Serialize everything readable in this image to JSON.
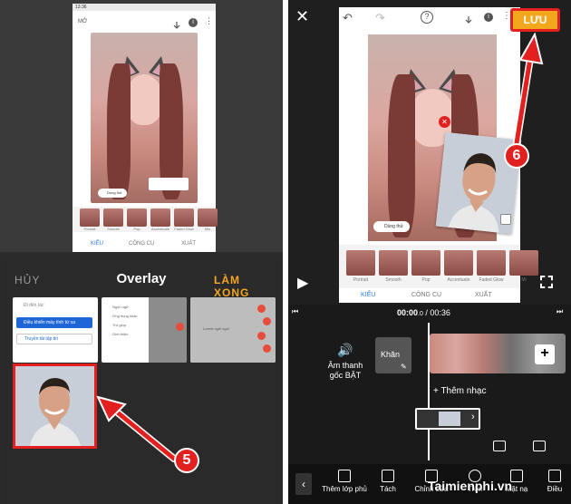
{
  "left": {
    "phone": {
      "status_time": "13:36",
      "header_label": "MỞ",
      "filters": [
        "Portrait",
        "Smooth",
        "Pop",
        "Accentuate",
        "Faded Glow",
        "Mis"
      ],
      "tabs": [
        "KIỂU",
        "CÔNG CỤ",
        "XUẤT"
      ],
      "dung_thu": "Dùng thử"
    },
    "sheet": {
      "cancel": "HỦY",
      "title": "Overlay",
      "done": "LÀM XONG",
      "grid_item1": {
        "line1": "Đi đến tác",
        "btn_blue": "Điều khiển máy tính từ xa",
        "btn_white": "Truyền tải tập tin"
      },
      "grid_item2": {
        "rows": [
          "Ngôn ngữ",
          "Ứng dụng khác",
          "Trợ giúp",
          "Giới thiệu"
        ]
      },
      "grid_item3": {
        "label": "Lorem ngôi ngồi"
      }
    },
    "step": "5"
  },
  "right": {
    "save": "LƯU",
    "step": "6",
    "filters": [
      "Portrait",
      "Smooth",
      "Pop",
      "Accentuate",
      "Faded Glow",
      "Mi"
    ],
    "tabs": [
      "KIỂU",
      "CÔNG CỤ",
      "XUẤT"
    ],
    "dung_thu": "Dùng thử",
    "time_current": "00:00",
    "time_ms": ".0",
    "time_total": "/ 00:36",
    "audio_label": "Âm thanh gốc BẬT",
    "cover_label": "Khăn",
    "add_music": "+ Thêm nhạc",
    "toolbar": [
      "Thêm lớp phủ",
      "Tách",
      "Chỉnh sửa",
      "Trộn",
      "Mặt nạ",
      "Điều"
    ],
    "watermark": "Taimienphi.vn"
  }
}
